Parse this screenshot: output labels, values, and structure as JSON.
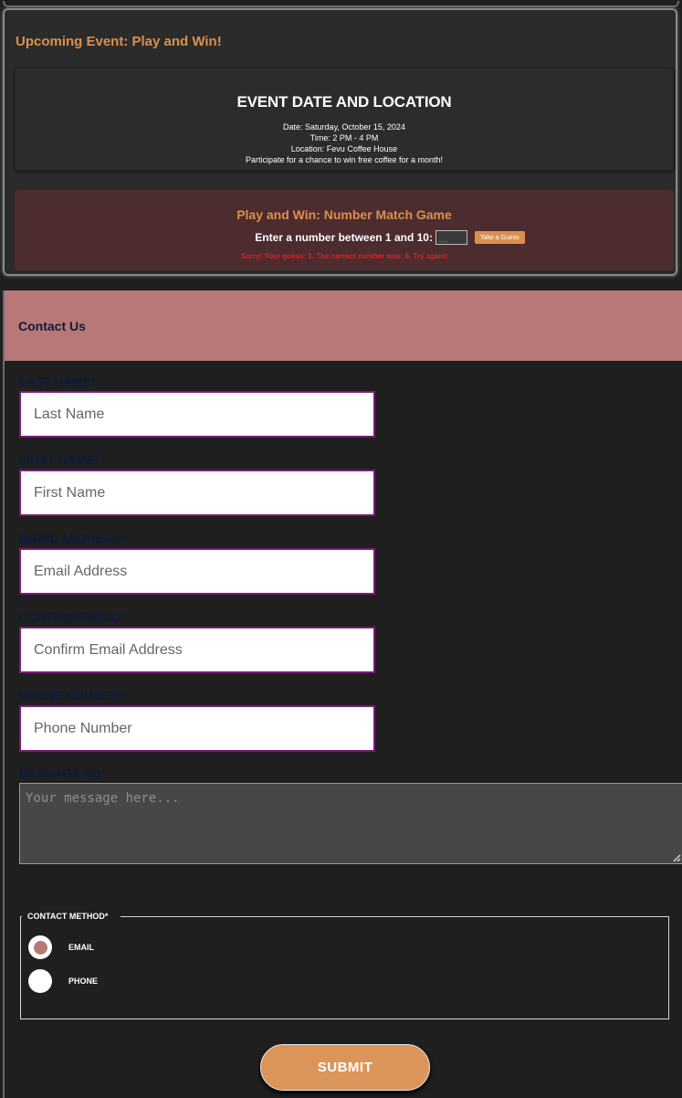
{
  "event": {
    "heading": "Upcoming Event: Play and Win!",
    "info_title": "EVENT DATE AND LOCATION",
    "date": "Date: Saturday, October 15, 2024",
    "time": "Time: 2 PM - 4 PM",
    "location": "Location: Fevu Coffee House",
    "description": "Participate for a chance to win free coffee for a month!"
  },
  "game": {
    "title": "Play and Win: Number Match Game",
    "prompt": "Enter a number between 1 and 10:",
    "input_placeholder": "__",
    "button_label": "Take a Guess",
    "result": "Sorry! Your guess: 1. The correct number was: 6. Try again!"
  },
  "contact": {
    "title": "Contact Us",
    "fields": {
      "last_name": {
        "label": "LAST NAME*",
        "placeholder": "Last Name"
      },
      "first_name": {
        "label": "FIRST NAME*",
        "placeholder": "First Name"
      },
      "email": {
        "label": "EMAIL ADDRESS*",
        "placeholder": "Email Address"
      },
      "confirm_email": {
        "label": "CONFIRM EMAIL*",
        "placeholder": "Confirm Email Address"
      },
      "phone": {
        "label": "PHONE NUMBER*",
        "placeholder": "Phone Number"
      },
      "message": {
        "label": "MESSAGE US*",
        "placeholder": "Your message here..."
      }
    },
    "contact_method": {
      "legend": "CONTACT METHOD*",
      "options": [
        {
          "label": "EMAIL",
          "selected": true
        },
        {
          "label": "PHONE",
          "selected": false
        }
      ]
    },
    "submit_label": "SUBMIT"
  },
  "colors": {
    "accent": "#dc8f4d",
    "header_bg": "#b87878",
    "label_navy": "#0d1b3e",
    "error_red": "#e02020",
    "input_border": "#7a1a7a"
  }
}
